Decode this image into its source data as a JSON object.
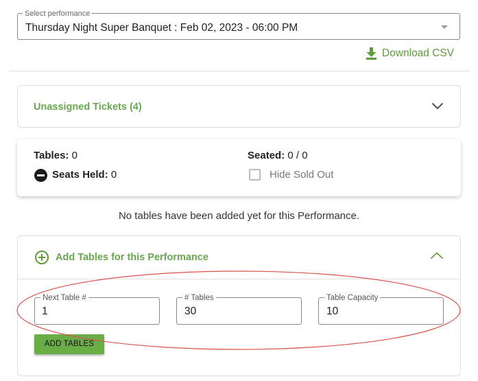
{
  "performance_select": {
    "label": "Select performance",
    "value": "Thursday Night Super Banquet : Feb 02, 2023 - 06:00 PM"
  },
  "download": {
    "label": "Download CSV",
    "icon": "download-icon"
  },
  "unassigned": {
    "title": "Unassigned Tickets (4)",
    "icon": "chevron-down-icon"
  },
  "stats": {
    "tables_label": "Tables:",
    "tables_value": " 0",
    "seated_label": "Seated:",
    "seated_value": " 0 / 0",
    "seats_held_label": "Seats Held:",
    "seats_held_value": " 0",
    "hide_sold_out_label": "Hide Sold Out",
    "hide_sold_out_checked": false
  },
  "empty_message": "No tables have been added yet for this Performance.",
  "add_tables": {
    "title": "Add Tables for this Performance",
    "expanded": true,
    "fields": [
      {
        "label": "Next Table #",
        "value": "1"
      },
      {
        "label": "# Tables",
        "value": "30"
      },
      {
        "label": "Table Capacity",
        "value": "10"
      }
    ],
    "button_label": "ADD TABLES"
  },
  "colors": {
    "accent_green": "#6aa84f",
    "button_green": "#6aac46",
    "annotation_red": "#d9534f"
  }
}
